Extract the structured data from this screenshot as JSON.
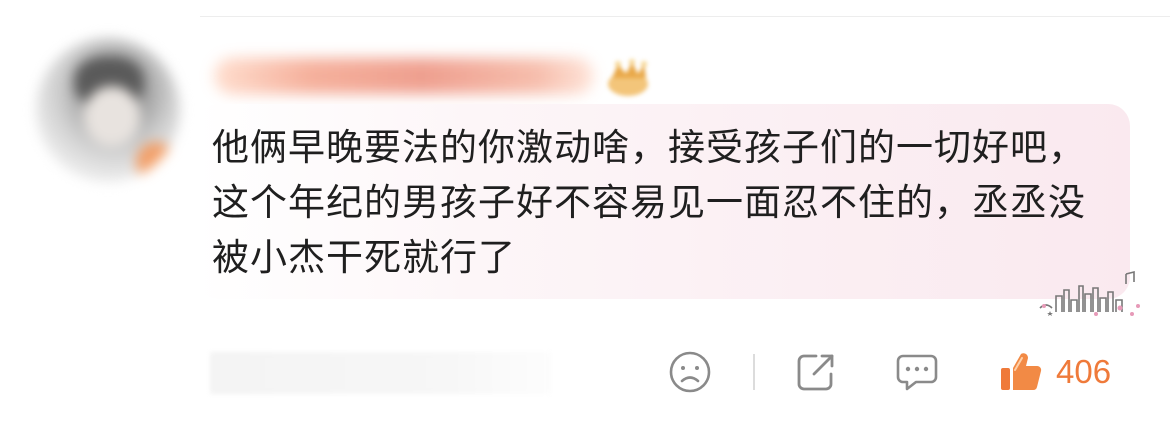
{
  "comment": {
    "text": "他俩早晚要法的你激动啥，接受孩子们的一切好吧，这个年纪的男孩子好不容易见一面忍不住的，丞丞没被小杰干死就行了"
  },
  "actions": {
    "dislike_icon": "sad-face-icon",
    "share_icon": "share-icon",
    "reply_icon": "comment-bubble-icon",
    "like_icon": "thumbs-up-icon",
    "like_count": "406"
  },
  "colors": {
    "like_accent": "#ef7a3a",
    "icon_gray": "#8a8a8a",
    "bubble_pink": "#fae9ef"
  }
}
